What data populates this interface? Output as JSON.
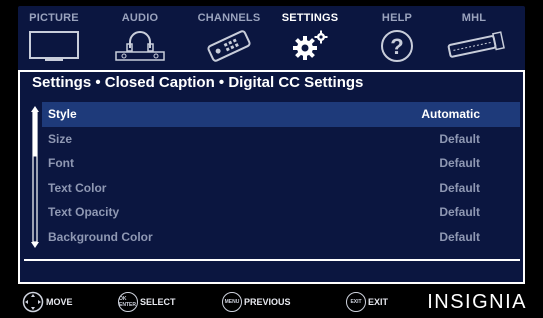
{
  "tabs": [
    {
      "label": "PICTURE",
      "icon": "tv-icon",
      "active": false
    },
    {
      "label": "AUDIO",
      "icon": "headphones-icon",
      "active": false
    },
    {
      "label": "CHANNELS",
      "icon": "remote-icon",
      "active": false
    },
    {
      "label": "SETTINGS",
      "icon": "gear-icon",
      "active": true
    },
    {
      "label": "HELP",
      "icon": "help-icon",
      "active": false
    },
    {
      "label": "MHL",
      "icon": "mhl-cable-icon",
      "active": false
    }
  ],
  "breadcrumb": "Settings • Closed Caption • Digital CC Settings",
  "settings": [
    {
      "label": "Style",
      "value": "Automatic"
    },
    {
      "label": "Size",
      "value": "Default"
    },
    {
      "label": "Font",
      "value": "Default"
    },
    {
      "label": "Text Color",
      "value": "Default"
    },
    {
      "label": "Text Opacity",
      "value": "Default"
    },
    {
      "label": "Background Color",
      "value": "Default"
    }
  ],
  "hints": {
    "move": "MOVE",
    "select": "SELECT",
    "select_icon": "OK ENTER",
    "previous": "PREVIOUS",
    "previous_icon": "MENU",
    "exit": "EXIT",
    "exit_icon": "EXIT"
  },
  "brand": "INSIGNIA",
  "colors": {
    "background": "#0b1640",
    "selected": "#1e3a7a",
    "text_dim": "#8f98b3"
  }
}
